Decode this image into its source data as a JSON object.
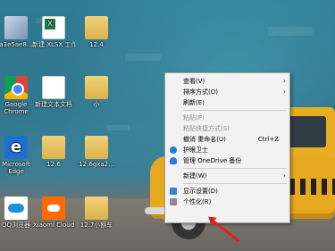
{
  "desktop": {
    "icons": [
      {
        "label": "a3e5ae8...",
        "icon": "user-photo-icon"
      },
      {
        "label": "新建 XLSX 工作表",
        "icon": "excel-file-icon"
      },
      {
        "label": "12.4",
        "icon": "folder-icon"
      },
      {
        "label": "Google Chrome",
        "icon": "chrome-icon"
      },
      {
        "label": "新建文本文档",
        "icon": "text-file-icon"
      },
      {
        "label": "小",
        "icon": "folder-icon"
      },
      {
        "label": "Microsoft Edge",
        "icon": "edge-icon"
      },
      {
        "label": "12.6",
        "icon": "folder-icon"
      },
      {
        "label": "12.6gxa2...",
        "icon": "folder-icon"
      },
      {
        "label": "QQ浏览器",
        "icon": "qq-browser-icon"
      },
      {
        "label": "Xiaomi Cloud",
        "icon": "xiaomi-cloud-icon"
      },
      {
        "label": "12.7小额车",
        "icon": "folder-icon"
      }
    ]
  },
  "context_menu": {
    "items": [
      {
        "label": "查看(V)"
      },
      {
        "label": "排序方式(O)"
      },
      {
        "label": "刷新(E)"
      },
      {
        "label": "粘贴(P)"
      },
      {
        "label": "粘贴快捷方式(S)"
      },
      {
        "label": "撤消 重命名(U)",
        "shortcut": "Ctrl+Z"
      },
      {
        "label": "护眼卫士"
      },
      {
        "label": "管理 OneDrive 备份"
      },
      {
        "label": "新建(W)"
      },
      {
        "label": "显示设置(D)"
      },
      {
        "label": "个性化(R)"
      }
    ],
    "arrow": "›"
  },
  "colors": {
    "menu_bg": "#f2f2f2",
    "annotation_arrow": "#e0211b",
    "car": "#e6a81e"
  }
}
